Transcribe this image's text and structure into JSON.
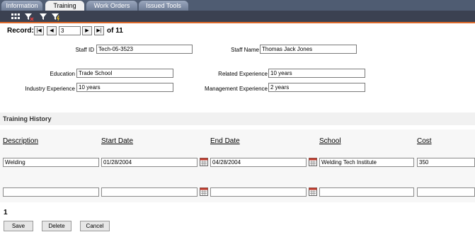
{
  "tabs": {
    "information": "Information",
    "training": "Training",
    "work_orders": "Work Orders",
    "issued_tools": "Issued Tools"
  },
  "toolbar": {
    "icons": [
      "grid-view-icon",
      "filter-remove-icon",
      "filter-icon",
      "filter-apply-icon"
    ],
    "accent": "#e06a2a"
  },
  "record_nav": {
    "label": "Record:",
    "first": "|◀",
    "prev": "◀",
    "current": "3",
    "next": "▶",
    "last": "▶|",
    "of_text": "of 11"
  },
  "form": {
    "staff_id_label": "Staff ID",
    "staff_id": "Tech-05-3523",
    "staff_name_label": "Staff Name",
    "staff_name": "Thomas Jack Jones",
    "education_label": "Education",
    "education": "Trade School",
    "related_exp_label": "Related Experience",
    "related_exp": "10 years",
    "industry_exp_label": "Industry Experience",
    "industry_exp": "10 years",
    "management_exp_label": "Management Experience",
    "management_exp": "2 years"
  },
  "training_history": {
    "title": "Training History",
    "columns": {
      "description": "Description",
      "start_date": "Start Date",
      "end_date": "End Date",
      "school": "School",
      "cost": "Cost"
    },
    "rows": [
      {
        "description": "Welding",
        "start_date": "01/28/2004",
        "end_date": "04/28/2004",
        "school": "Welding Tech Institute",
        "cost": "350"
      },
      {
        "description": "",
        "start_date": "",
        "end_date": "",
        "school": "",
        "cost": ""
      }
    ]
  },
  "pager": {
    "page": "1"
  },
  "buttons": {
    "save": "Save",
    "delete": "Delete",
    "cancel": "Cancel"
  }
}
